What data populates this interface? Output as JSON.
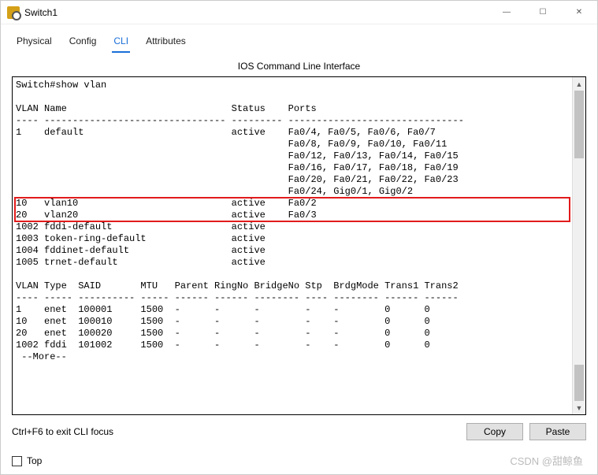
{
  "window": {
    "title": "Switch1",
    "min": "—",
    "max": "☐",
    "close": "✕"
  },
  "tabs": {
    "t0": "Physical",
    "t1": "Config",
    "t2": "CLI",
    "t3": "Attributes",
    "active": "CLI"
  },
  "panel_title": "IOS Command Line Interface",
  "cli": {
    "prompt_line": "Switch#show vlan",
    "hdr_vlan": "VLAN Name                             Status    Ports",
    "hdr_dashes1": "---- -------------------------------- --------- -------------------------------",
    "rows_main": [
      "1    default                          active    Fa0/4, Fa0/5, Fa0/6, Fa0/7",
      "                                                Fa0/8, Fa0/9, Fa0/10, Fa0/11",
      "                                                Fa0/12, Fa0/13, Fa0/14, Fa0/15",
      "                                                Fa0/16, Fa0/17, Fa0/18, Fa0/19",
      "                                                Fa0/20, Fa0/21, Fa0/22, Fa0/23",
      "                                                Fa0/24, Gig0/1, Gig0/2",
      "10   vlan10                           active    Fa0/2",
      "20   vlan20                           active    Fa0/3",
      "1002 fddi-default                     active    ",
      "1003 token-ring-default               active    ",
      "1004 fddinet-default                  active    ",
      "1005 trnet-default                    active    "
    ],
    "hdr2": "VLAN Type  SAID       MTU   Parent RingNo BridgeNo Stp  BrdgMode Trans1 Trans2",
    "hdr_dashes2": "---- ----- ---------- ----- ------ ------ -------- ---- -------- ------ ------",
    "rows2": [
      "1    enet  100001     1500  -      -      -        -    -        0      0",
      "10   enet  100010     1500  -      -      -        -    -        0      0",
      "20   enet  100020     1500  -      -      -        -    -        0      0",
      "1002 fddi  101002     1500  -      -      -        -    -        0      0"
    ],
    "more": " --More--"
  },
  "footer": {
    "hint": "Ctrl+F6 to exit CLI focus",
    "copy": "Copy",
    "paste": "Paste"
  },
  "checkbox_label": "Top",
  "watermark": "CSDN @甜鲸鱼"
}
